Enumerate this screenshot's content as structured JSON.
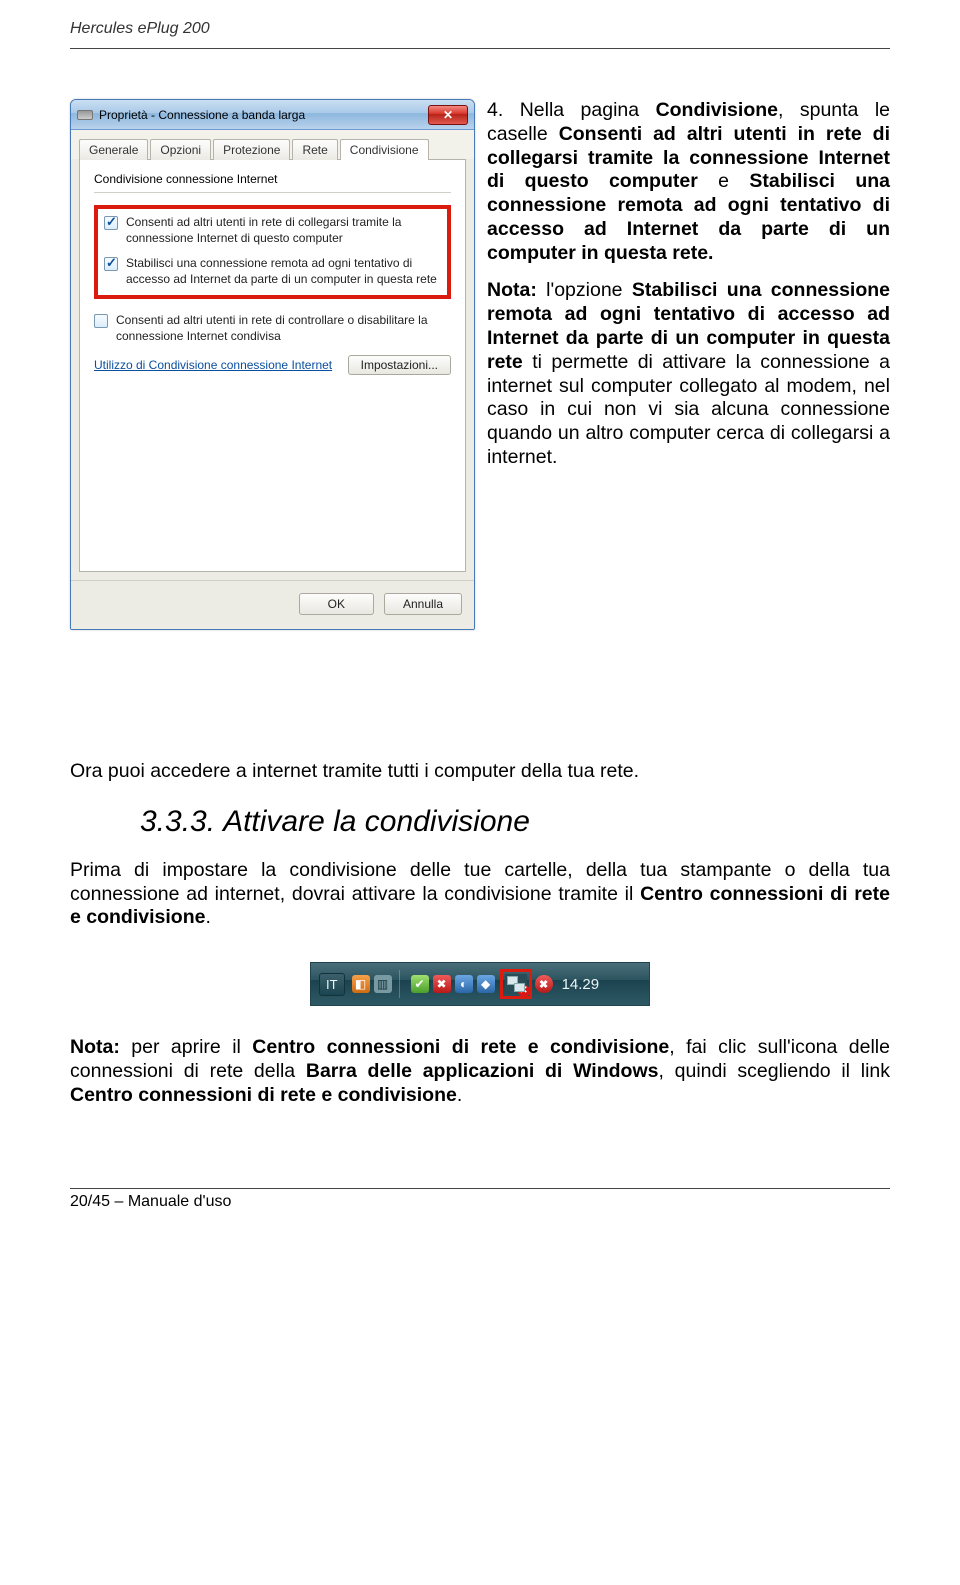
{
  "header": {
    "title": "Hercules ePlug 200"
  },
  "dialog": {
    "title": "Proprietà - Connessione a banda larga",
    "tabs": [
      "Generale",
      "Opzioni",
      "Protezione",
      "Rete",
      "Condivisione"
    ],
    "activeTab": "Condivisione",
    "groupTitle": "Condivisione connessione Internet",
    "check1": "Consenti ad altri utenti in rete di collegarsi tramite la connessione Internet di questo computer",
    "check2": "Stabilisci una connessione remota ad ogni tentativo di accesso ad Internet da parte di un computer in questa rete",
    "check3": "Consenti ad altri utenti in rete di controllare o disabilitare la connessione Internet condivisa",
    "link": "Utilizzo di Condivisione connessione Internet",
    "settingsBtn": "Impostazioni...",
    "okBtn": "OK",
    "cancelBtn": "Annulla"
  },
  "step4": {
    "intro1a": "4. Nella pagina ",
    "intro1b": "Condivisione",
    "intro1c": ", spunta le caselle ",
    "intro1d": "Consenti ad altri utenti in rete di collegarsi tramite la connessione Internet di questo computer",
    "intro1e": " e ",
    "intro1f": "Stabilisci una connessione remota ad ogni tentativo di accesso ad Internet da parte di un computer in questa rete.",
    "note_label": "Nota:",
    "note_body_a": " l'opzione ",
    "note_body_b": "Stabilisci una connessione remota ad ogni tentativo di accesso ad Internet da parte di un computer in questa rete",
    "note_body_c": " ti permette di attivare la connessione a internet sul computer collegato al modem, nel caso in cui non vi sia alcuna connessione quando un altro computer cerca di collegarsi a internet."
  },
  "after": {
    "line": "Ora puoi accedere a internet tramite tutti i computer della tua rete."
  },
  "subheading": {
    "number": "3.3.3.",
    "title": "Attivare la condivisione"
  },
  "body2": {
    "a": "Prima di impostare la condivisione delle tue cartelle, della tua stampante o della tua connessione ad internet, dovrai attivare la condivisione tramite il ",
    "b": "Centro connessioni di rete e condivisione",
    "c": "."
  },
  "tray": {
    "lang": "IT",
    "time": "14.29"
  },
  "note2": {
    "label": "Nota:",
    "a": " per aprire il ",
    "b": "Centro connessioni di rete e condivisione",
    "c": ", fai clic sull'icona delle connessioni di rete della ",
    "d": "Barra delle applicazioni di Windows",
    "e": ", quindi scegliendo il link ",
    "f": "Centro connessioni di rete e condivisione",
    "g": "."
  },
  "footer": {
    "text": "20/45 – Manuale d'uso"
  }
}
